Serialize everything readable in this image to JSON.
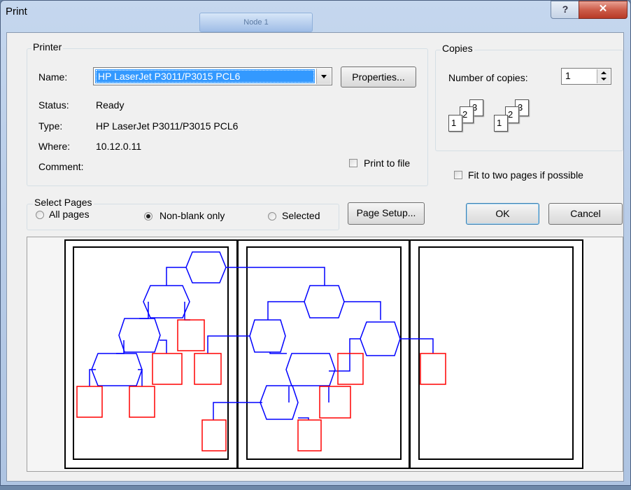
{
  "window": {
    "title": "Print",
    "background_tab": "Node 1"
  },
  "printer": {
    "group_label": "Printer",
    "name_label": "Name:",
    "name_value": "HP LaserJet P3011/P3015 PCL6",
    "properties_button": "Properties...",
    "status_label": "Status:",
    "status_value": "Ready",
    "type_label": "Type:",
    "type_value": "HP LaserJet P3011/P3015 PCL6",
    "where_label": "Where:",
    "where_value": "10.12.0.11",
    "comment_label": "Comment:",
    "print_to_file": "Print to file"
  },
  "copies": {
    "group_label": "Copies",
    "number_label": "Number of copies:",
    "number_value": "1",
    "collate_pages": [
      "1",
      "2",
      "3"
    ]
  },
  "fit_option": "Fit to two pages if possible",
  "select_pages": {
    "group_label": "Select Pages",
    "options": [
      "All pages",
      "Non-blank only",
      "Selected"
    ],
    "selected": "Non-blank only"
  },
  "buttons": {
    "page_setup": "Page Setup...",
    "ok": "OK",
    "cancel": "Cancel"
  },
  "colors": {
    "node_stroke": "#0000ff",
    "leaf_stroke": "#ff0000",
    "title_close": "#c74b36"
  }
}
